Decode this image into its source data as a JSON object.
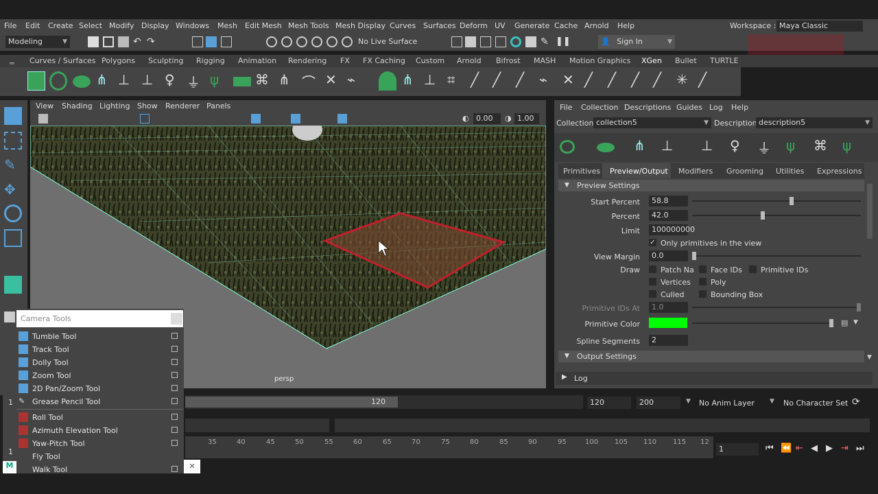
{
  "menubar": {
    "items": [
      "File",
      "Edit",
      "Create",
      "Select",
      "Modify",
      "Display",
      "Windows",
      "Mesh",
      "Edit Mesh",
      "Mesh Tools",
      "Mesh Display",
      "Curves",
      "Surfaces",
      "Deform",
      "UV",
      "Generate",
      "Cache",
      "Arnold",
      "Help"
    ],
    "workspace_label": "Workspace :",
    "workspace_value": "Maya Classic"
  },
  "statusline": {
    "mode": "Modeling",
    "live_surface": "No Live Surface",
    "sign_in": "Sign In"
  },
  "shelf": {
    "tabs": [
      "Curves / Surfaces",
      "Polygons",
      "Sculpting",
      "Rigging",
      "Animation",
      "Rendering",
      "FX",
      "FX Caching",
      "Custom",
      "Arnold",
      "Bifrost",
      "MASH",
      "Motion Graphics",
      "XGen",
      "Bullet",
      "TURTLE"
    ],
    "active_tab": "XGen"
  },
  "viewport": {
    "menu": [
      "View",
      "Shading",
      "Lighting",
      "Show",
      "Renderer",
      "Panels"
    ],
    "field_a": "0.00",
    "field_b": "1.00",
    "camera_label": "persp"
  },
  "camera_tools": {
    "title": "Camera Tools",
    "items": [
      "Tumble Tool",
      "Track Tool",
      "Dolly Tool",
      "Zoom Tool",
      "2D Pan/Zoom Tool",
      "Grease Pencil Tool",
      "Roll Tool",
      "Azimuth Elevation Tool",
      "Yaw-Pitch Tool",
      "Fly Tool",
      "Walk Tool"
    ]
  },
  "timeline": {
    "range_end": "120",
    "ticks": [
      "35",
      "40",
      "45",
      "50",
      "55",
      "60",
      "65",
      "70",
      "75",
      "80",
      "85",
      "90",
      "95",
      "100",
      "105",
      "110",
      "115",
      "12"
    ],
    "left_frame_a": "1",
    "left_frame_b": "1",
    "current_frame": "1",
    "playback_end": "120",
    "anim_end": "200",
    "anim_layer": "No Anim Layer",
    "character_set": "No Character Set"
  },
  "xgen": {
    "menu": [
      "File",
      "Collection",
      "Descriptions",
      "Guides",
      "Log",
      "Help"
    ],
    "collection_label": "Collection",
    "collection_value": "collection5",
    "description_label": "Description",
    "description_value": "description5",
    "tabs": [
      "Primitives",
      "Preview/Output",
      "Modifiers",
      "Grooming",
      "Utilities",
      "Expressions"
    ],
    "active_tab": "Preview/Output",
    "preview_settings": {
      "title": "Preview Settings",
      "start_percent_label": "Start Percent",
      "start_percent": "58.8",
      "start_percent_frac": 0.588,
      "percent_label": "Percent",
      "percent": "42.0",
      "percent_frac": 0.42,
      "limit_label": "Limit",
      "limit": "100000000",
      "only_in_view": "Only primitives in the view",
      "view_margin_label": "View Margin",
      "view_margin": "0.0",
      "draw_label": "Draw",
      "draw_options": [
        "Patch Na",
        "Face IDs",
        "Primitive IDs",
        "Vertices",
        "Poly",
        "Culled",
        "Bounding Box"
      ],
      "primitive_ids_at_label": "Primitive IDs At",
      "primitive_ids_at": "1.0",
      "primitive_color_label": "Primitive Color",
      "primitive_color": "#00ff00",
      "spline_segments_label": "Spline Segments",
      "spline_segments": "2"
    },
    "output_settings_title": "Output Settings",
    "log_title": "Log"
  },
  "colors": {
    "accent_blue": "#5aa0d8",
    "selection_red": "#c0202a",
    "shelf_green": "#3aa35a"
  }
}
